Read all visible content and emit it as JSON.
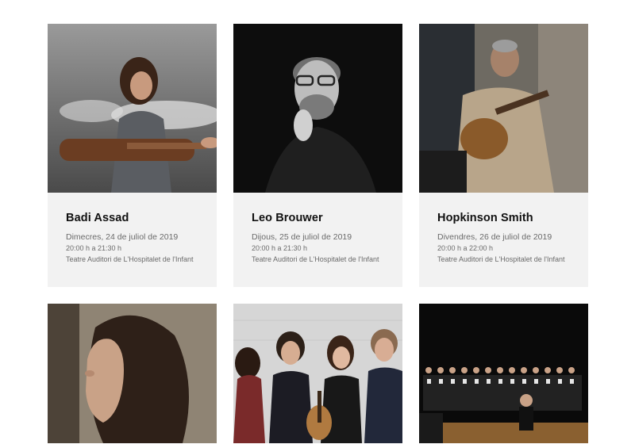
{
  "events": [
    {
      "name": "Badi Assad",
      "date": "Dimecres, 24 de juliol de 2019",
      "time": "20:00 h a 21:30 h",
      "venue": "Teatre Auditori de L'Hospitalet de l'Infant",
      "image": "photo-woman-guitar-splash"
    },
    {
      "name": "Leo Brouwer",
      "date": "Dijous, 25 de juliol de 2019",
      "time": "20:00 h a 21:30 h",
      "venue": "Teatre Auditori de L'Hospitalet de l'Infant",
      "image": "photo-man-glasses-bw"
    },
    {
      "name": "Hopkinson Smith",
      "date": "Divendres, 26 de juliol de 2019",
      "time": "20:00 h a 22:00 h",
      "venue": "Teatre Auditori de L'Hospitalet de l'Infant",
      "image": "photo-man-lute"
    }
  ],
  "more_events": [
    {
      "image": "photo-woman-profile"
    },
    {
      "image": "photo-guitar-quartet"
    },
    {
      "image": "photo-choir-stage"
    }
  ],
  "colors": {
    "card_bg": "#f2f2f2",
    "title": "#111111",
    "meta": "#6b6b6b"
  }
}
